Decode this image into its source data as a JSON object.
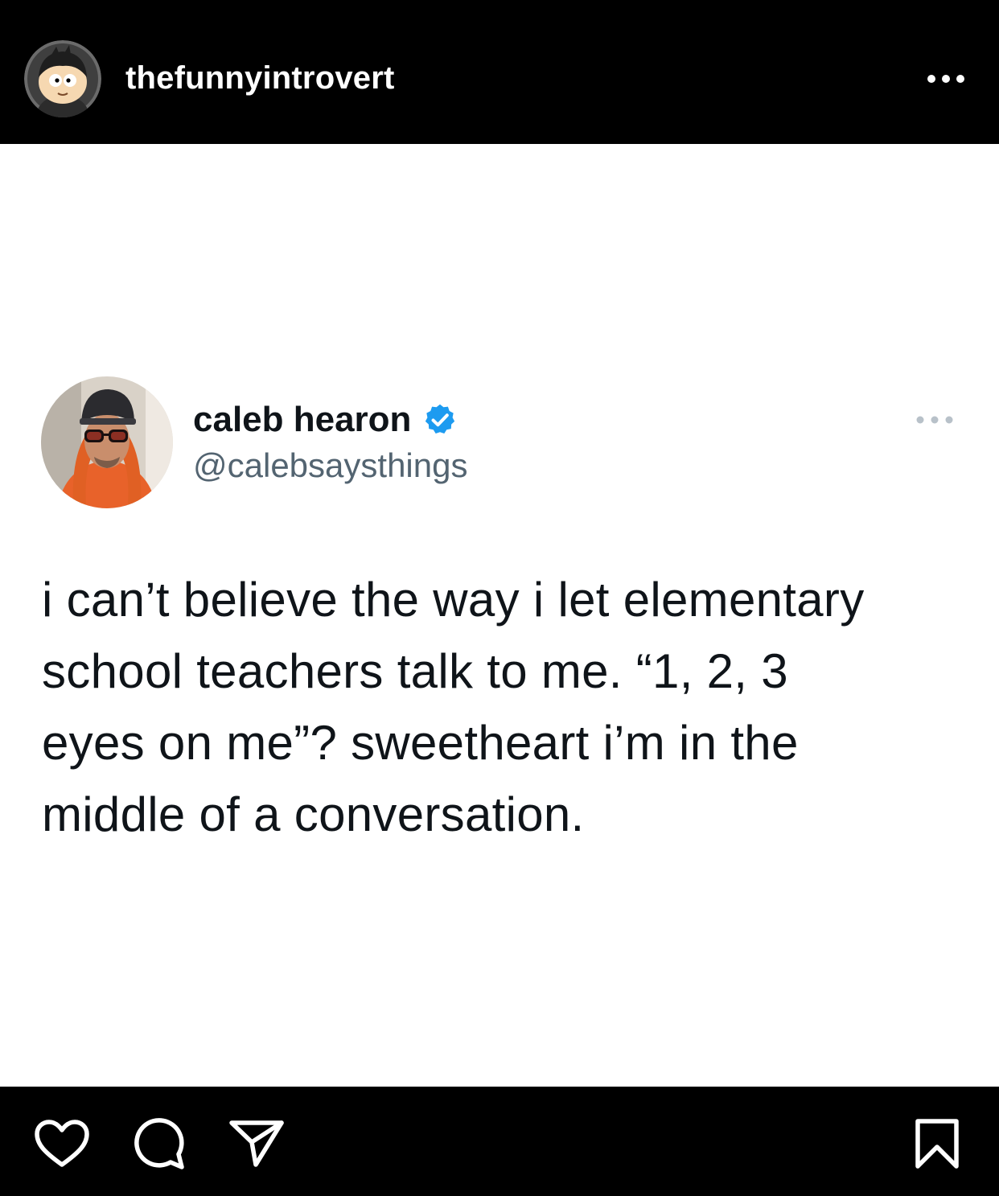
{
  "header": {
    "username": "thefunnyintrovert",
    "avatar_icon": "cartoon-avatar",
    "more_icon": "more-horizontal-icon"
  },
  "tweet": {
    "display_name": "caleb hearon",
    "verified_color": "#1d9bf0",
    "handle": "@calebsaysthings",
    "lines": [
      "i can’t believe the way i let elementary",
      "school teachers talk to me. “1, 2, 3",
      "eyes on me”? sweetheart i’m in the",
      "middle of a conversation."
    ]
  },
  "actions": {
    "like_icon": "heart-icon",
    "comment_icon": "comment-icon",
    "share_icon": "send-icon",
    "save_icon": "bookmark-icon"
  }
}
